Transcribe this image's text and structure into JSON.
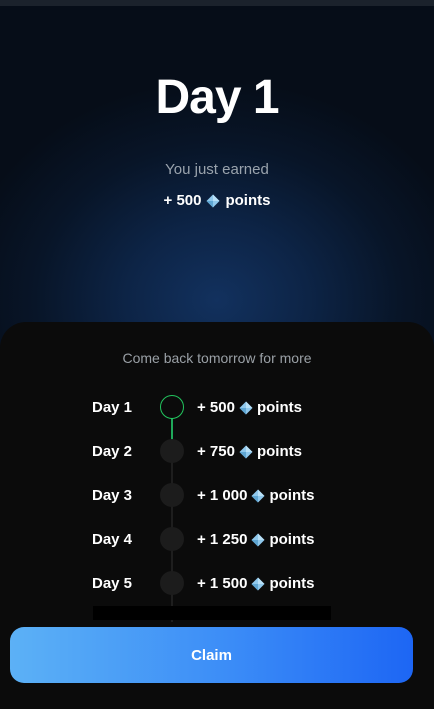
{
  "header": {
    "title": "Day 1",
    "subtitle": "You just earned",
    "points": {
      "prefix": "+ 500",
      "suffix": "points",
      "icon": "diamond-icon"
    }
  },
  "rewards": {
    "title": "Come back tomorrow for more",
    "items": [
      {
        "day": "Day 1",
        "points_prefix": "+ 500",
        "points_suffix": "points",
        "active": true
      },
      {
        "day": "Day 2",
        "points_prefix": "+ 750",
        "points_suffix": "points",
        "active": false
      },
      {
        "day": "Day 3",
        "points_prefix": "+ 1 000",
        "points_suffix": "points",
        "active": false
      },
      {
        "day": "Day 4",
        "points_prefix": "+ 1 250",
        "points_suffix": "points",
        "active": false
      },
      {
        "day": "Day 5",
        "points_prefix": "+ 1 500",
        "points_suffix": "points",
        "active": false
      }
    ]
  },
  "claim_button": {
    "label": "Claim"
  },
  "colors": {
    "accent_green": "#22c55e",
    "button_gradient_start": "#5cb1f6",
    "button_gradient_end": "#1d66f4",
    "diamond": "#8fc8ec"
  }
}
